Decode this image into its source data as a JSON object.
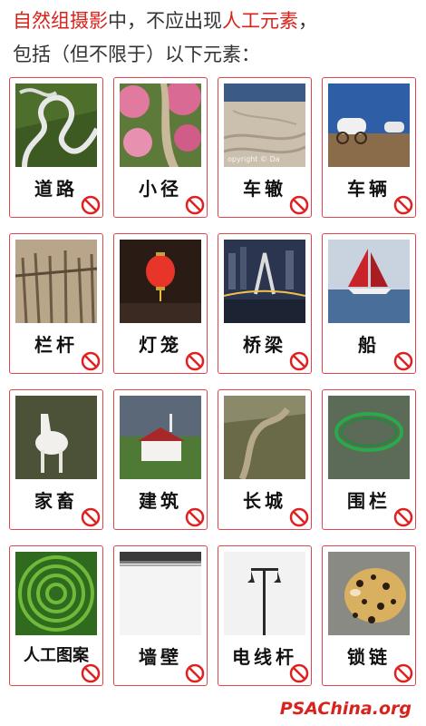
{
  "header": {
    "line1_red1": "自然组摄影",
    "line1_black": "中，不应出现",
    "line1_red2": "人工元素",
    "line1_end": "，",
    "line2": "包括（但不限于）以下元素："
  },
  "colors": {
    "accent": "#d9221c",
    "card_border": "#e3434a",
    "ban_icon": "#e02020"
  },
  "items": [
    {
      "label": "道路"
    },
    {
      "label": "小径"
    },
    {
      "label": "车辙",
      "photo_text": "opyright © Da"
    },
    {
      "label": "车辆"
    },
    {
      "label": "栏杆"
    },
    {
      "label": "灯笼"
    },
    {
      "label": "桥梁"
    },
    {
      "label": "船"
    },
    {
      "label": "家畜"
    },
    {
      "label": "建筑"
    },
    {
      "label": "长城"
    },
    {
      "label": "围栏"
    },
    {
      "label": "人工图案"
    },
    {
      "label": "墙壁"
    },
    {
      "label": "电线杆"
    },
    {
      "label": "锁链"
    }
  ],
  "ban_icon": "prohibited-icon",
  "watermark": "PSAChina.org"
}
